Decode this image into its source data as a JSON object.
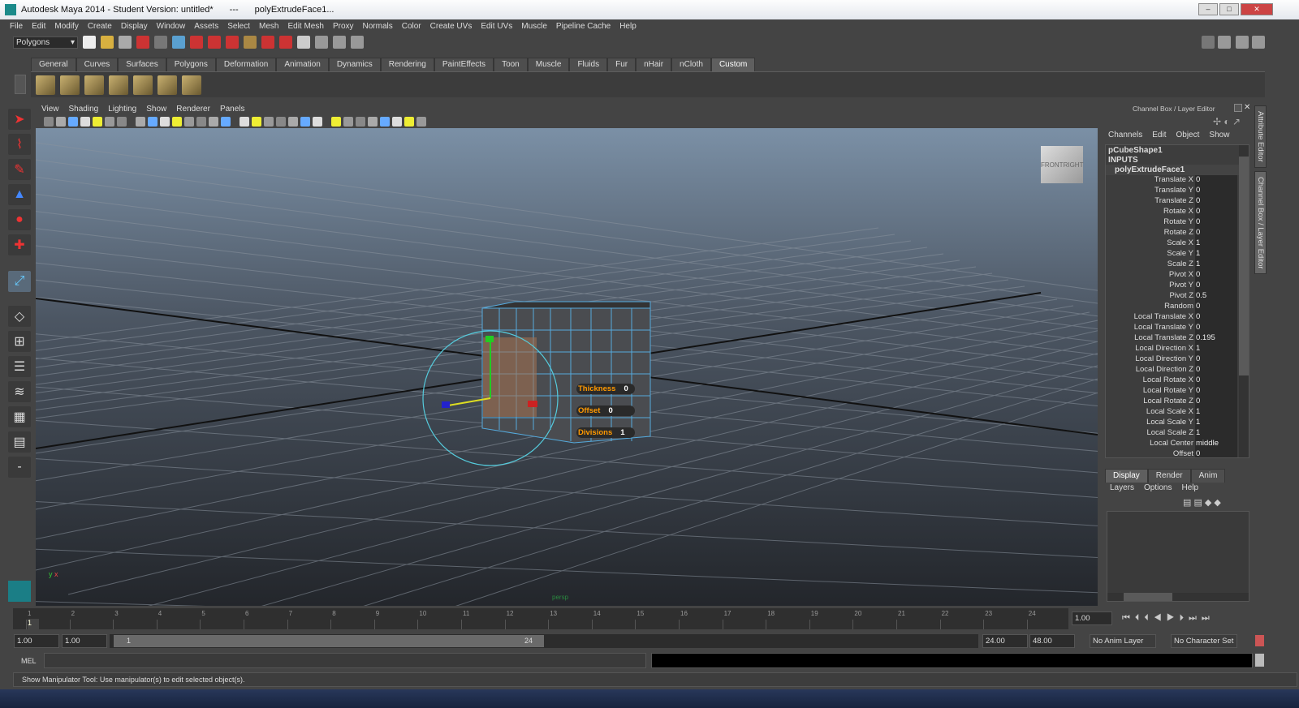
{
  "window": {
    "title": "Autodesk Maya 2014 - Student Version: untitled*",
    "separator": "---",
    "subtitle": "polyExtrudeFace1..."
  },
  "menu": [
    "File",
    "Edit",
    "Modify",
    "Create",
    "Display",
    "Window",
    "Assets",
    "Select",
    "Mesh",
    "Edit Mesh",
    "Proxy",
    "Normals",
    "Color",
    "Create UVs",
    "Edit UVs",
    "Muscle",
    "Pipeline Cache",
    "Help"
  ],
  "menuset": "Polygons",
  "shelf_tabs": [
    "General",
    "Curves",
    "Surfaces",
    "Polygons",
    "Deformation",
    "Animation",
    "Dynamics",
    "Rendering",
    "PaintEffects",
    "Toon",
    "Muscle",
    "Fluids",
    "Fur",
    "nHair",
    "nCloth",
    "Custom"
  ],
  "active_shelf": "Custom",
  "panel_menu": [
    "View",
    "Shading",
    "Lighting",
    "Show",
    "Renderer",
    "Panels"
  ],
  "viewport": {
    "camera": "persp",
    "viewcube": [
      "FRONT",
      "RIGHT"
    ],
    "axis": [
      "y",
      "x"
    ],
    "manip": [
      {
        "label": "Thickness",
        "value": "0"
      },
      {
        "label": "Offset",
        "value": "0"
      },
      {
        "label": "Divisions",
        "value": "1"
      }
    ]
  },
  "channel_box": {
    "title": "Channel Box / Layer Editor",
    "menu": [
      "Channels",
      "Edit",
      "Object",
      "Show"
    ],
    "shape": "pCubeShape1",
    "inputs": "INPUTS",
    "node": "polyExtrudeFace1",
    "attrs": [
      [
        "Translate X",
        "0"
      ],
      [
        "Translate Y",
        "0"
      ],
      [
        "Translate Z",
        "0"
      ],
      [
        "Rotate X",
        "0"
      ],
      [
        "Rotate Y",
        "0"
      ],
      [
        "Rotate Z",
        "0"
      ],
      [
        "Scale X",
        "1"
      ],
      [
        "Scale Y",
        "1"
      ],
      [
        "Scale Z",
        "1"
      ],
      [
        "Pivot X",
        "0"
      ],
      [
        "Pivot Y",
        "0"
      ],
      [
        "Pivot Z",
        "0.5"
      ],
      [
        "Random",
        "0"
      ],
      [
        "Local Translate X",
        "0"
      ],
      [
        "Local Translate Y",
        "0"
      ],
      [
        "Local Translate Z",
        "0.195"
      ],
      [
        "Local Direction X",
        "1"
      ],
      [
        "Local Direction Y",
        "0"
      ],
      [
        "Local Direction Z",
        "0"
      ],
      [
        "Local Rotate X",
        "0"
      ],
      [
        "Local Rotate Y",
        "0"
      ],
      [
        "Local Rotate Z",
        "0"
      ],
      [
        "Local Scale X",
        "1"
      ],
      [
        "Local Scale Y",
        "1"
      ],
      [
        "Local Scale Z",
        "1"
      ],
      [
        "Local Center",
        "middle"
      ],
      [
        "Offset",
        "0"
      ]
    ]
  },
  "layer_editor": {
    "tabs": [
      "Display",
      "Render",
      "Anim"
    ],
    "menu": [
      "Layers",
      "Options",
      "Help"
    ]
  },
  "side_tabs": [
    "Attribute Editor",
    "Channel Box / Layer Editor"
  ],
  "time": {
    "ticks": [
      "1",
      "2",
      "3",
      "4",
      "5",
      "6",
      "7",
      "8",
      "9",
      "10",
      "11",
      "12",
      "13",
      "14",
      "15",
      "16",
      "17",
      "18",
      "19",
      "20",
      "21",
      "22",
      "23",
      "24"
    ],
    "current": "1",
    "current_field": "1.00",
    "range_start": "1.00",
    "playback_start": "1.00",
    "slider_min": "1",
    "slider_max": "24",
    "playback_end": "24.00",
    "range_end": "48.00",
    "anim_layer": "No Anim Layer",
    "char_set": "No Character Set"
  },
  "cmd": {
    "label": "MEL"
  },
  "status": "Show Manipulator Tool: Use manipulator(s) to edit selected object(s)."
}
